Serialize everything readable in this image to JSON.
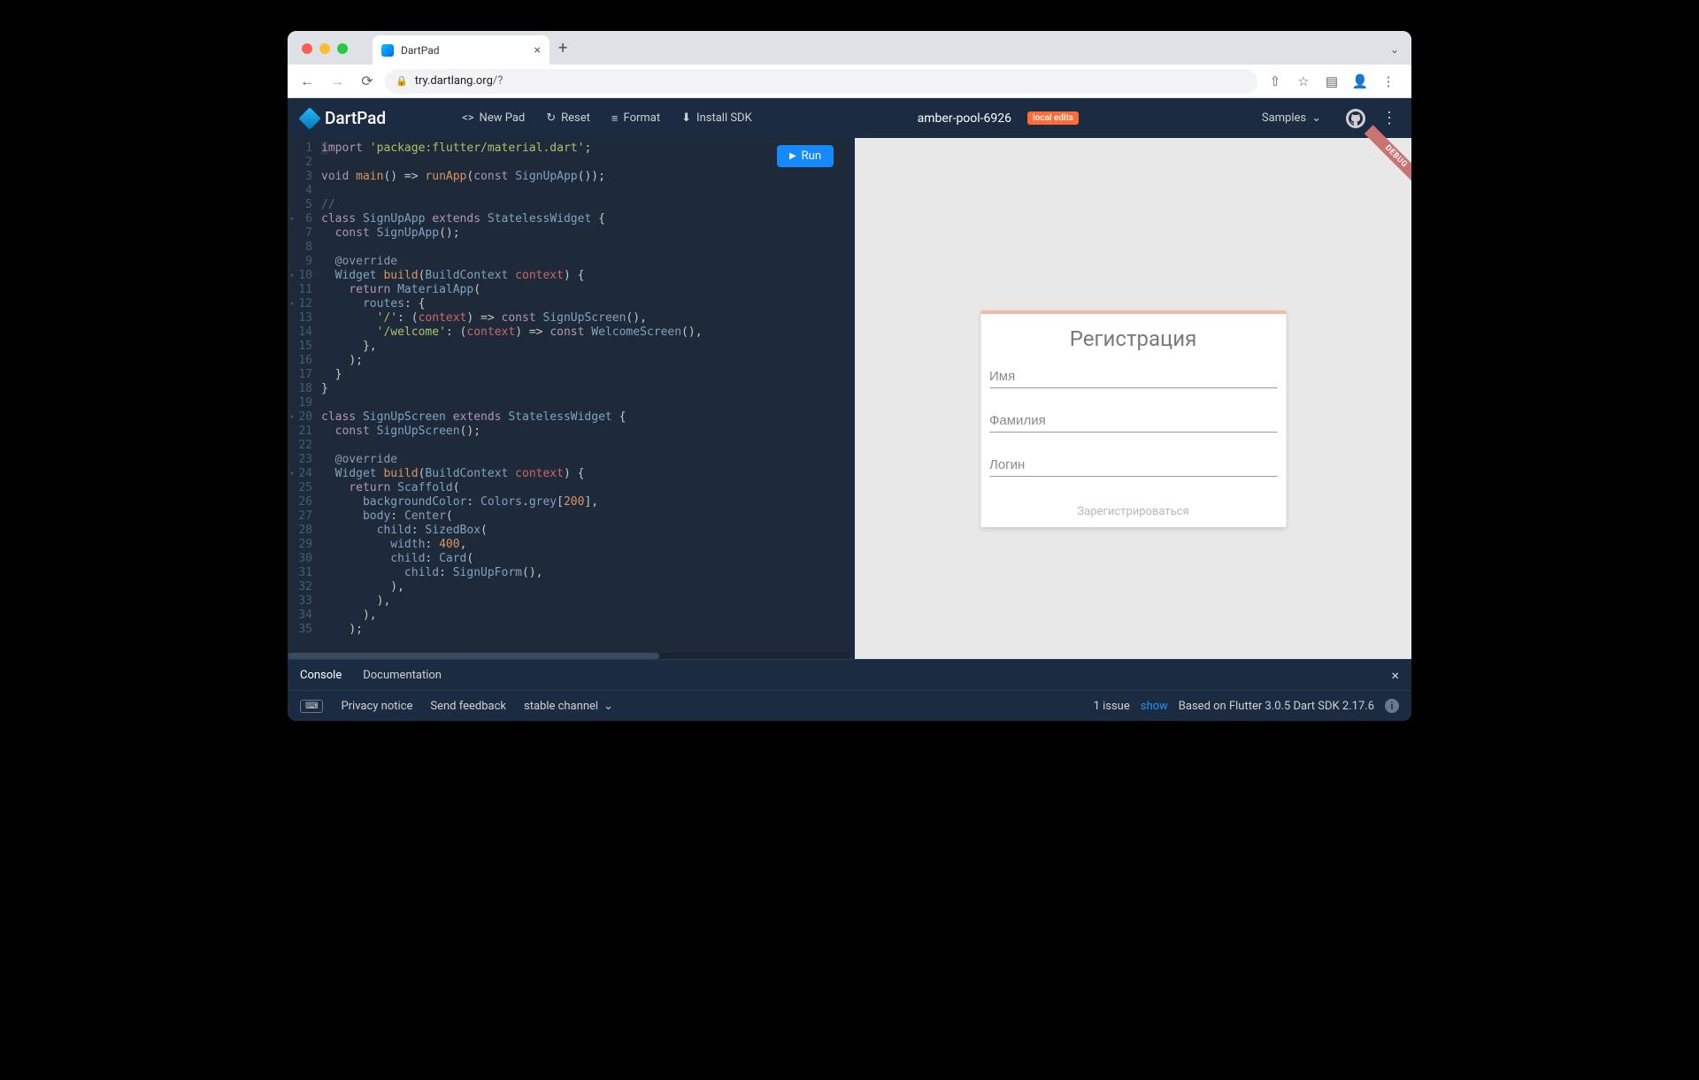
{
  "browser": {
    "tab_title": "DartPad",
    "url_host": "try.dartlang.org",
    "url_path": "/?"
  },
  "topbar": {
    "app_name": "DartPad",
    "new_pad": "New Pad",
    "reset": "Reset",
    "format": "Format",
    "install_sdk": "Install SDK",
    "project_name": "amber-pool-6926",
    "local_edits": "local edits",
    "samples": "Samples"
  },
  "run_button": "Run",
  "code_lines": [
    {
      "n": 1,
      "fold": false,
      "html": "<span class='first-char tok-import'>i</span><span class='tok-import'>mport</span> <span class='tok-str'>'package:flutter/material.dart'</span><span class='tok-p'>;</span>"
    },
    {
      "n": 2,
      "fold": false,
      "html": ""
    },
    {
      "n": 3,
      "fold": false,
      "html": "<span class='tok-kw'>void</span> <span class='tok-fn'>main</span><span class='tok-p'>() =&gt; </span><span class='tok-fn'>runApp</span><span class='tok-p'>(</span><span class='tok-kw'>const</span> <span class='tok-type'>SignUpApp</span><span class='tok-p'>());</span>"
    },
    {
      "n": 4,
      "fold": false,
      "html": ""
    },
    {
      "n": 5,
      "fold": false,
      "html": "<span class='tok-cmt'>//</span>"
    },
    {
      "n": 6,
      "fold": true,
      "html": "<span class='tok-kw'>class</span> <span class='tok-type'>SignUpApp</span> <span class='tok-kw'>extends</span> <span class='tok-type'>StatelessWidget</span> <span class='tok-p'>{</span>"
    },
    {
      "n": 7,
      "fold": false,
      "html": "  <span class='tok-kw'>const</span> <span class='tok-type'>SignUpApp</span><span class='tok-p'>();</span>"
    },
    {
      "n": 8,
      "fold": false,
      "html": ""
    },
    {
      "n": 9,
      "fold": false,
      "html": "  <span class='tok-anno'>@override</span>"
    },
    {
      "n": 10,
      "fold": true,
      "html": "  <span class='tok-type'>Widget</span> <span class='tok-fn'>build</span><span class='tok-p'>(</span><span class='tok-type'>BuildContext</span> <span class='tok-arg'>context</span><span class='tok-p'>) {</span>"
    },
    {
      "n": 11,
      "fold": false,
      "html": "    <span class='tok-kw'>return</span> <span class='tok-type'>MaterialApp</span><span class='tok-p'>(</span>"
    },
    {
      "n": 12,
      "fold": true,
      "html": "      <span class='tok-id'>routes</span><span class='tok-p'>: {</span>"
    },
    {
      "n": 13,
      "fold": false,
      "html": "        <span class='tok-str'>'/'</span><span class='tok-p'>: (</span><span class='tok-arg'>context</span><span class='tok-p'>) =&gt; </span><span class='tok-kw'>const</span> <span class='tok-type'>SignUpScreen</span><span class='tok-p'>(),</span>"
    },
    {
      "n": 14,
      "fold": false,
      "html": "        <span class='tok-str'>'/welcome'</span><span class='tok-p'>: (</span><span class='tok-arg'>context</span><span class='tok-p'>) =&gt; </span><span class='tok-kw'>const</span> <span class='tok-type'>WelcomeScreen</span><span class='tok-p'>(),</span>"
    },
    {
      "n": 15,
      "fold": false,
      "html": "      <span class='tok-p'>},</span>"
    },
    {
      "n": 16,
      "fold": false,
      "html": "    <span class='tok-p'>);</span>"
    },
    {
      "n": 17,
      "fold": false,
      "html": "  <span class='tok-p'>}</span>"
    },
    {
      "n": 18,
      "fold": false,
      "html": "<span class='tok-p'>}</span>"
    },
    {
      "n": 19,
      "fold": false,
      "html": ""
    },
    {
      "n": 20,
      "fold": true,
      "html": "<span class='tok-kw'>class</span> <span class='tok-type'>SignUpScreen</span> <span class='tok-kw'>extends</span> <span class='tok-type'>StatelessWidget</span> <span class='tok-p'>{</span>"
    },
    {
      "n": 21,
      "fold": false,
      "html": "  <span class='tok-kw'>const</span> <span class='tok-type'>SignUpScreen</span><span class='tok-p'>();</span>"
    },
    {
      "n": 22,
      "fold": false,
      "html": ""
    },
    {
      "n": 23,
      "fold": false,
      "html": "  <span class='tok-anno'>@override</span>"
    },
    {
      "n": 24,
      "fold": true,
      "html": "  <span class='tok-type'>Widget</span> <span class='tok-fn'>build</span><span class='tok-p'>(</span><span class='tok-type'>BuildContext</span> <span class='tok-arg'>context</span><span class='tok-p'>) {</span>"
    },
    {
      "n": 25,
      "fold": false,
      "html": "    <span class='tok-kw'>return</span> <span class='tok-type'>Scaffold</span><span class='tok-p'>(</span>"
    },
    {
      "n": 26,
      "fold": false,
      "html": "      <span class='tok-id'>backgroundColor</span><span class='tok-p'>: </span><span class='tok-type'>Colors</span><span class='tok-p'>.</span><span class='tok-id'>grey</span><span class='tok-p'>[</span><span class='tok-num'>200</span><span class='tok-p'>],</span>"
    },
    {
      "n": 27,
      "fold": false,
      "html": "      <span class='tok-id'>body</span><span class='tok-p'>: </span><span class='tok-type'>Center</span><span class='tok-p'>(</span>"
    },
    {
      "n": 28,
      "fold": false,
      "html": "        <span class='tok-id'>child</span><span class='tok-p'>: </span><span class='tok-type'>SizedBox</span><span class='tok-p'>(</span>"
    },
    {
      "n": 29,
      "fold": false,
      "html": "          <span class='tok-id'>width</span><span class='tok-p'>: </span><span class='tok-num'>400</span><span class='tok-p'>,</span>"
    },
    {
      "n": 30,
      "fold": false,
      "html": "          <span class='tok-id'>child</span><span class='tok-p'>: </span><span class='tok-type'>Card</span><span class='tok-p'>(</span>"
    },
    {
      "n": 31,
      "fold": false,
      "html": "            <span class='tok-id'>child</span><span class='tok-p'>: </span><span class='tok-type'>SignUpForm</span><span class='tok-p'>(),</span>"
    },
    {
      "n": 32,
      "fold": false,
      "html": "          <span class='tok-p'>),</span>"
    },
    {
      "n": 33,
      "fold": false,
      "html": "        <span class='tok-p'>),</span>"
    },
    {
      "n": 34,
      "fold": false,
      "html": "      <span class='tok-p'>),</span>"
    },
    {
      "n": 35,
      "fold": false,
      "html": "    <span class='tok-p'>);</span>"
    }
  ],
  "preview": {
    "debug": "DEBUG",
    "title": "Регистрация",
    "fields": {
      "first_name": "Имя",
      "last_name": "Фамилия",
      "login": "Логин"
    },
    "submit": "Зарегистрироваться"
  },
  "console": {
    "console_tab": "Console",
    "documentation_tab": "Documentation"
  },
  "status": {
    "privacy": "Privacy notice",
    "feedback": "Send feedback",
    "channel": "stable channel",
    "issues_count": "1 issue",
    "show": "show",
    "sdk": "Based on Flutter 3.0.5 Dart SDK 2.17.6"
  }
}
